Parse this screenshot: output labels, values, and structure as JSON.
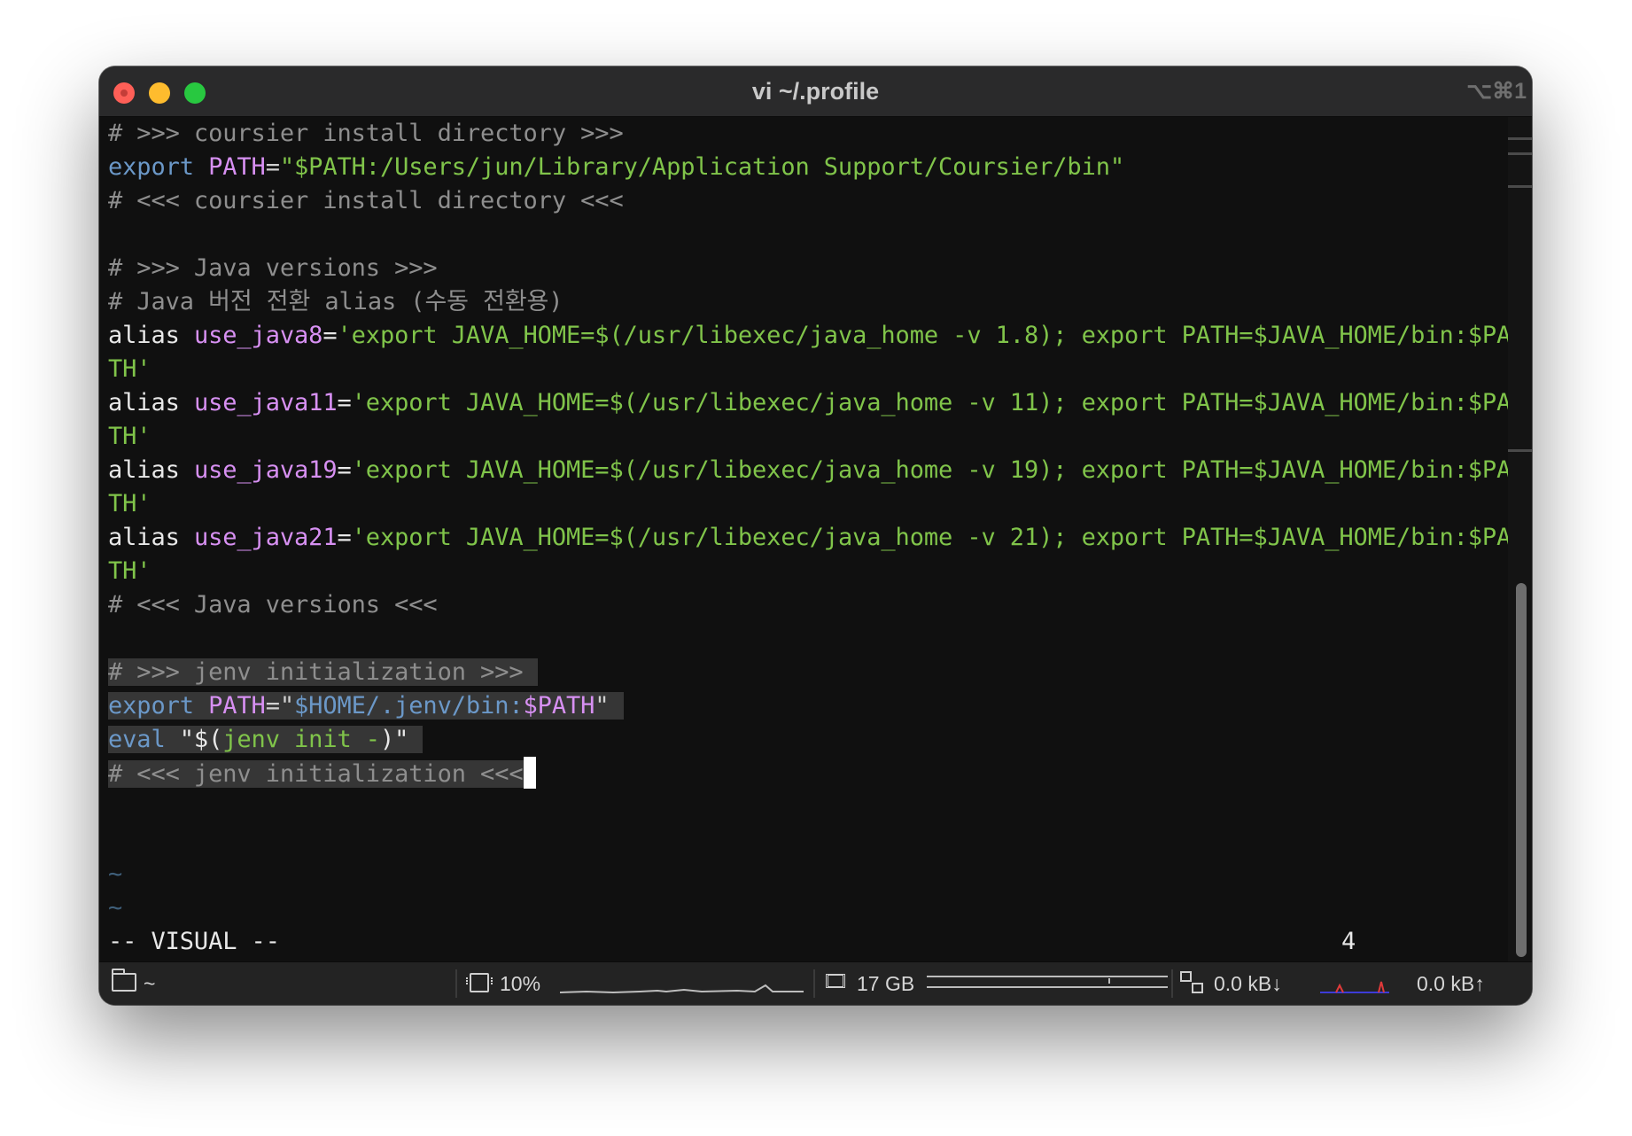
{
  "window": {
    "title": "vi ~/.profile",
    "shortcut": "⌥⌘1"
  },
  "editor": {
    "lines": [
      {
        "comment": "# >>> coursier install directory >>>"
      },
      {
        "kw": "export",
        "var": "PATH",
        "eq": "=",
        "str": "\"$PATH:/Users/jun/Library/Application Support/Coursier/bin\""
      },
      {
        "comment": "# <<< coursier install directory <<<"
      },
      {
        "comment": "# >>> Java versions >>>"
      },
      {
        "comment": "# Java 버전 전환 alias (수동 전환용)"
      },
      {
        "kw": "alias",
        "var": "use_java8",
        "eq": "=",
        "str": "'export JAVA_HOME=$(/usr/libexec/java_home -v 1.8); export PATH=$JAVA_HOME/bin:$PA",
        "wrap": "TH'"
      },
      {
        "kw": "alias",
        "var": "use_java11",
        "eq": "=",
        "str": "'export JAVA_HOME=$(/usr/libexec/java_home -v 11); export PATH=$JAVA_HOME/bin:$PA",
        "wrap": "TH'"
      },
      {
        "kw": "alias",
        "var": "use_java19",
        "eq": "=",
        "str": "'export JAVA_HOME=$(/usr/libexec/java_home -v 19); export PATH=$JAVA_HOME/bin:$PA",
        "wrap": "TH'"
      },
      {
        "kw": "alias",
        "var": "use_java21",
        "eq": "=",
        "str": "'export JAVA_HOME=$(/usr/libexec/java_home -v 21); export PATH=$JAVA_HOME/bin:$PA",
        "wrap": "TH'"
      },
      {
        "comment": "# <<< Java versions <<<"
      },
      {
        "comment": "# >>> jenv initialization >>>"
      },
      {
        "kw": "export",
        "var": "PATH",
        "eq": "=",
        "q1": "\"",
        "str": "$HOME/.jenv/bin:",
        "var2": "$PATH",
        "q2": "\""
      },
      {
        "kw": "eval",
        "q1": "\"$(",
        "str": "jenv init -",
        "q2": ")\""
      },
      {
        "comment": "# <<< jenv initialization <<<"
      }
    ],
    "tildes": [
      "~",
      "~"
    ],
    "mode": "-- VISUAL --",
    "selection_count": "4"
  },
  "statusbar": {
    "cwd": "~",
    "cpu": "10%",
    "memory": "17 GB",
    "net_down": "0.0 kB↓",
    "net_up": "0.0 kB↑"
  },
  "colors": {
    "comment": "#8e8e8e",
    "keyword": "#6b98c8",
    "variable": "#d790f2",
    "string": "#80c44a",
    "selection": "#363636"
  },
  "icons": [
    "close-icon",
    "minimize-icon",
    "zoom-icon",
    "folder-icon",
    "cpu-icon",
    "memory-icon",
    "network-icon"
  ]
}
